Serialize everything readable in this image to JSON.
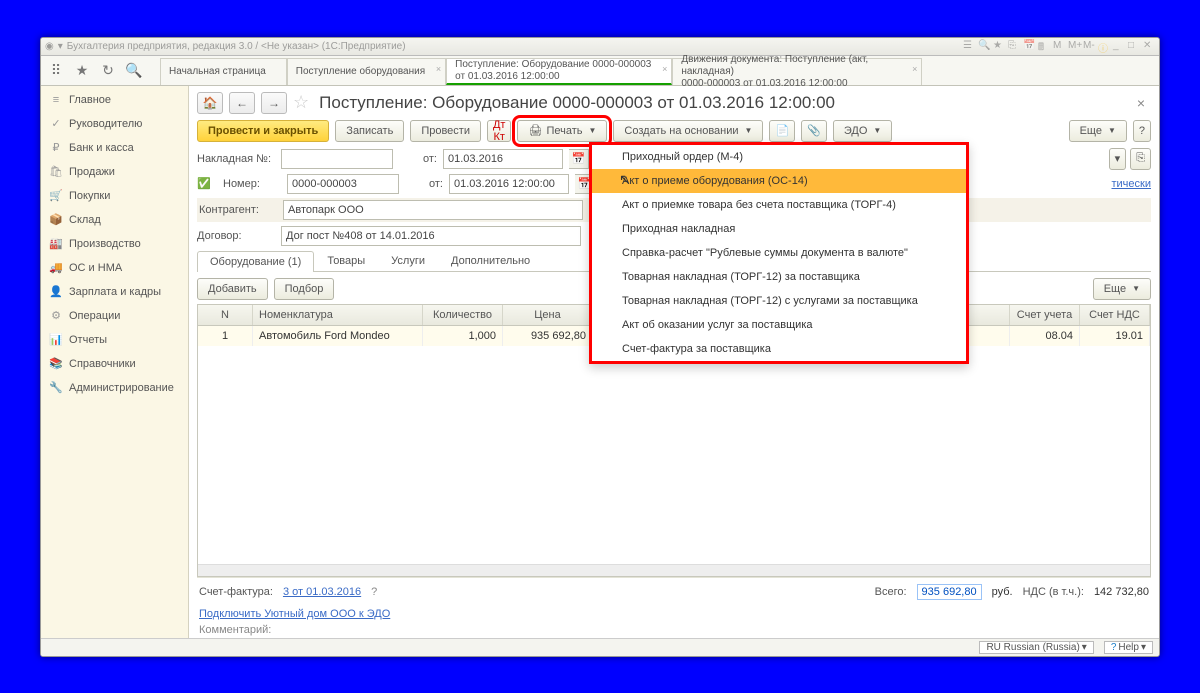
{
  "titlebar": {
    "title": "Бухгалтерия предприятия, редакция 3.0 / <Не указан> (1С:Предприятие)"
  },
  "top_tabs": [
    {
      "line1": "Начальная страница",
      "line2": ""
    },
    {
      "line1": "Поступление оборудования",
      "line2": ""
    },
    {
      "line1": "Поступление: Оборудование 0000-000003",
      "line2": "от 01.03.2016 12:00:00",
      "active": true
    },
    {
      "line1": "Движения документа: Поступление (акт, накладная)",
      "line2": "0000-000003 от 01.03.2016 12:00:00"
    }
  ],
  "sidebar": [
    {
      "icon": "≡",
      "label": "Главное"
    },
    {
      "icon": "✓",
      "label": "Руководителю"
    },
    {
      "icon": "₽",
      "label": "Банк и касса"
    },
    {
      "icon": "🛍",
      "label": "Продажи"
    },
    {
      "icon": "🛒",
      "label": "Покупки"
    },
    {
      "icon": "📦",
      "label": "Склад"
    },
    {
      "icon": "🏭",
      "label": "Производство"
    },
    {
      "icon": "🚚",
      "label": "ОС и НМА"
    },
    {
      "icon": "👤",
      "label": "Зарплата и кадры"
    },
    {
      "icon": "⚙",
      "label": "Операции"
    },
    {
      "icon": "📊",
      "label": "Отчеты"
    },
    {
      "icon": "📚",
      "label": "Справочники"
    },
    {
      "icon": "🔧",
      "label": "Администрирование"
    }
  ],
  "page": {
    "title": "Поступление: Оборудование 0000-000003 от 01.03.2016 12:00:00",
    "buttons": {
      "provesti_zakryt": "Провести и закрыть",
      "zapisat": "Записать",
      "provesti": "Провести",
      "pechat": "Печать",
      "sozdat": "Создать на основании",
      "edo": "ЭДО",
      "eshe": "Еще"
    },
    "form": {
      "nakladnaya_label": "Накладная №:",
      "nakladnaya_value": "",
      "ot": "от:",
      "date1": "01.03.2016",
      "nomer_label": "Номер:",
      "nomer_value": "0000-000003",
      "date2": "01.03.2016 12:00:00",
      "kontragent_label": "Контрагент:",
      "kontragent_value": "Автопарк ООО",
      "dogovor_label": "Договор:",
      "dogovor_value": "Дог пост №408 от 14.01.2016",
      "auto_link": "тически"
    },
    "tabs2": [
      "Оборудование (1)",
      "Товары",
      "Услуги",
      "Дополнительно"
    ],
    "btn_dobavit": "Добавить",
    "btn_podbor": "Подбор",
    "grid": {
      "cols": [
        "N",
        "Номенклатура",
        "Количество",
        "Цена",
        "",
        "Счет учета",
        "Счет НДС"
      ],
      "rows": [
        {
          "n": "1",
          "nom": "Автомобиль Ford Mondeo",
          "kol": "1,000",
          "cena": "935 692,80",
          "su": "08.04",
          "nds": "19.01"
        }
      ]
    },
    "footer": {
      "sf_label": "Счет-фактура:",
      "sf_link": "3 от 01.03.2016",
      "vsego": "Всего:",
      "vsego_val": "935 692,80",
      "rub": "руб.",
      "nds_label": "НДС (в т.ч.):",
      "nds_val": "142 732,80",
      "edo_link": "Подключить Уютный дом ООО к ЭДО",
      "komm_label": "Комментарий:"
    }
  },
  "print_menu": [
    "Приходный ордер (М-4)",
    "Акт о приеме оборудования (ОС-14)",
    "Акт о приемке товара без счета поставщика (ТОРГ-4)",
    "Приходная накладная",
    "Справка-расчет \"Рублевые суммы документа в валюте\"",
    "Товарная накладная (ТОРГ-12) за поставщика",
    "Товарная накладная (ТОРГ-12) с услугами за поставщика",
    "Акт об оказании услуг за поставщика",
    "Счет-фактура за поставщика"
  ],
  "status": {
    "lang": "RU Russian (Russia)",
    "help": "Help"
  }
}
